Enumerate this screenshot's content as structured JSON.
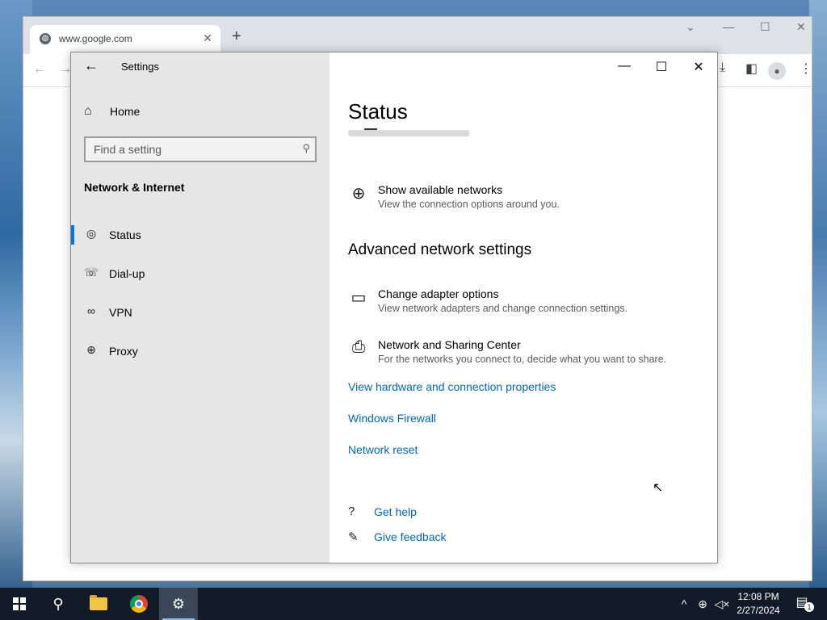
{
  "browser": {
    "tab_title": "www.google.com",
    "tab_close": "✕",
    "new_tab": "+",
    "favicon": "globe-icon"
  },
  "settings": {
    "app_title": "Settings",
    "back": "←",
    "home_label": "Home",
    "search_placeholder": "Find a setting",
    "section_title": "Network & Internet",
    "nav": [
      {
        "label": "Status",
        "icon": "status-globe-icon"
      },
      {
        "label": "Dial-up",
        "icon": "dialup-icon"
      },
      {
        "label": "VPN",
        "icon": "vpn-icon"
      },
      {
        "label": "Proxy",
        "icon": "globe-icon"
      }
    ],
    "page_title": "Status",
    "show_networks": {
      "title": "Show available networks",
      "desc": "View the connection options around you."
    },
    "advanced_title": "Advanced network settings",
    "adapter": {
      "title": "Change adapter options",
      "desc": "View network adapters and change connection settings."
    },
    "sharing": {
      "title": "Network and Sharing Center",
      "desc": "For the networks you connect to, decide what you want to share."
    },
    "links": [
      "View hardware and connection properties",
      "Windows Firewall",
      "Network reset"
    ],
    "get_help": "Get help",
    "give_feedback": "Give feedback"
  },
  "taskbar": {
    "time": "12:08 PM",
    "date": "2/27/2024",
    "notification_count": "1"
  },
  "colors": {
    "accent": "#0078d7",
    "link": "#0067b8",
    "taskbar": "#101b27"
  }
}
